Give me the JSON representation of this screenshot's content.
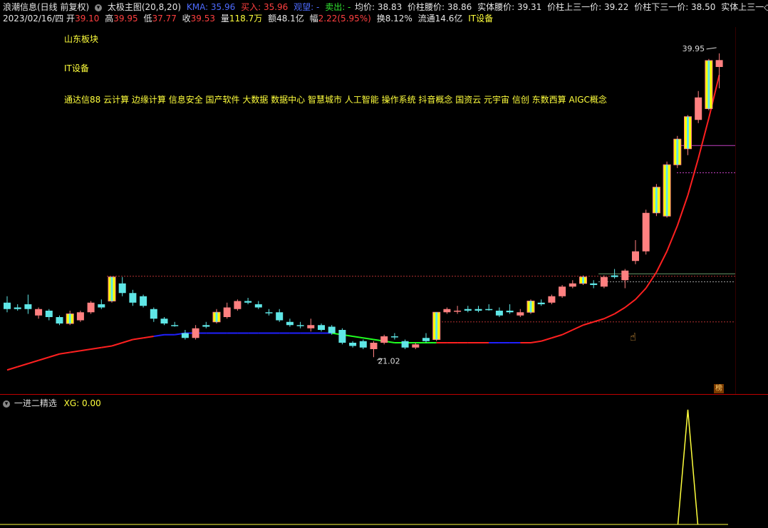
{
  "header": {
    "stock_name": "浪潮信息(日线 前复权)",
    "indicator_name": "太极主图(20,8,20)",
    "kma_label": "KMA: 35.96",
    "buy_label": "买入: 35.96",
    "watch_label": "观望: -",
    "sell_label": "卖出: -",
    "avg_price": "均价: 38.83",
    "pillar_waist": "价柱腰价: 38.86",
    "body_waist": "实体腰价: 39.31",
    "pillar_upper_third": "价柱上三一价: 39.22",
    "pillar_lower_third": "价柱下三一价: 38.50",
    "body_upper_third": "实体上三一◇"
  },
  "quote": {
    "date": "2023/02/16/四",
    "open_label": "开",
    "open": "39.10",
    "high_label": "高",
    "high": "39.95",
    "low_label": "低",
    "low": "37.77",
    "close_label": "收",
    "close": "39.53",
    "volume_label": "量",
    "volume": "118.7万",
    "amount_label": "额",
    "amount": "48.1亿",
    "change_label": "幅",
    "change": "2.22(5.95%)",
    "turnover_label": "换",
    "turnover": "8.12%",
    "float_label": "流通",
    "float": "14.6亿",
    "sector": "IT设备"
  },
  "annotations": {
    "region": "山东板块",
    "industry": "IT设备",
    "concepts": "通达信88 云计算 边缘计算 信息安全 国产软件 大数据 数据中心 智慧城市 人工智能 操作系统 抖音概念 国资云 元宇宙 信创 东数西算 AIGC概念"
  },
  "main_chart": {
    "high_marker": "39.95",
    "low_marker": "21.02",
    "badge": "榜"
  },
  "sub_chart": {
    "title": "一进二精选",
    "xg_label": "XG: 0.00"
  },
  "colors": {
    "up": "#ff8080",
    "down": "#5fe6e6",
    "strong_up": "#ffff00",
    "ma_red": "#ff2020",
    "ma_blue": "#2020ff",
    "ma_green": "#20ff20",
    "signal": "#ffff3c"
  },
  "chart_data": {
    "type": "candlestick",
    "price_range": [
      19.5,
      41.5
    ],
    "candles": [
      {
        "o": 24.4,
        "c": 24.0,
        "h": 24.8,
        "l": 23.8,
        "k": "d"
      },
      {
        "o": 24.0,
        "c": 24.1,
        "h": 24.3,
        "l": 23.9,
        "k": "d"
      },
      {
        "o": 24.0,
        "c": 24.3,
        "h": 24.9,
        "l": 23.7,
        "k": "d"
      },
      {
        "o": 24.0,
        "c": 23.6,
        "h": 24.1,
        "l": 23.4,
        "k": "u"
      },
      {
        "o": 23.9,
        "c": 23.5,
        "h": 24.0,
        "l": 23.3,
        "k": "d"
      },
      {
        "o": 23.5,
        "c": 23.1,
        "h": 23.6,
        "l": 23.0,
        "k": "d"
      },
      {
        "o": 23.1,
        "c": 23.7,
        "h": 23.9,
        "l": 23.0,
        "k": "y"
      },
      {
        "o": 23.3,
        "c": 23.8,
        "h": 23.9,
        "l": 23.2,
        "k": "u"
      },
      {
        "o": 23.8,
        "c": 24.4,
        "h": 24.5,
        "l": 23.7,
        "k": "u"
      },
      {
        "o": 24.1,
        "c": 24.3,
        "h": 24.6,
        "l": 24.0,
        "k": "d"
      },
      {
        "o": 24.5,
        "c": 26.0,
        "h": 26.0,
        "l": 24.4,
        "k": "y"
      },
      {
        "o": 25.6,
        "c": 25.0,
        "h": 26.0,
        "l": 24.8,
        "k": "d"
      },
      {
        "o": 25.0,
        "c": 24.4,
        "h": 25.2,
        "l": 24.2,
        "k": "d"
      },
      {
        "o": 24.8,
        "c": 24.2,
        "h": 24.9,
        "l": 24.1,
        "k": "d"
      },
      {
        "o": 24.0,
        "c": 23.4,
        "h": 24.1,
        "l": 23.2,
        "k": "d"
      },
      {
        "o": 23.4,
        "c": 23.1,
        "h": 23.5,
        "l": 23.0,
        "k": "d"
      },
      {
        "o": 23.0,
        "c": 23.0,
        "h": 23.2,
        "l": 22.9,
        "k": "d"
      },
      {
        "o": 22.2,
        "c": 22.5,
        "h": 22.7,
        "l": 22.1,
        "k": "d"
      },
      {
        "o": 22.2,
        "c": 22.8,
        "h": 23.0,
        "l": 22.1,
        "k": "u"
      },
      {
        "o": 22.9,
        "c": 23.0,
        "h": 23.2,
        "l": 22.8,
        "k": "d"
      },
      {
        "o": 23.2,
        "c": 23.8,
        "h": 24.0,
        "l": 23.1,
        "k": "y"
      },
      {
        "o": 23.5,
        "c": 24.1,
        "h": 24.4,
        "l": 23.4,
        "k": "u"
      },
      {
        "o": 24.0,
        "c": 24.5,
        "h": 24.6,
        "l": 23.9,
        "k": "u"
      },
      {
        "o": 24.5,
        "c": 24.4,
        "h": 24.7,
        "l": 24.3,
        "k": "d"
      },
      {
        "o": 24.3,
        "c": 24.1,
        "h": 24.5,
        "l": 24.0,
        "k": "d"
      },
      {
        "o": 23.8,
        "c": 23.8,
        "h": 24.0,
        "l": 23.6,
        "k": "d"
      },
      {
        "o": 23.8,
        "c": 23.3,
        "h": 24.0,
        "l": 23.2,
        "k": "d"
      },
      {
        "o": 23.2,
        "c": 23.0,
        "h": 23.4,
        "l": 22.9,
        "k": "d"
      },
      {
        "o": 23.0,
        "c": 23.0,
        "h": 23.2,
        "l": 22.8,
        "k": "d"
      },
      {
        "o": 22.8,
        "c": 23.0,
        "h": 23.4,
        "l": 22.6,
        "k": "u"
      },
      {
        "o": 23.0,
        "c": 22.7,
        "h": 23.1,
        "l": 22.6,
        "k": "d"
      },
      {
        "o": 22.9,
        "c": 22.5,
        "h": 23.0,
        "l": 22.4,
        "k": "d"
      },
      {
        "o": 22.7,
        "c": 21.9,
        "h": 22.8,
        "l": 21.8,
        "k": "d"
      },
      {
        "o": 21.9,
        "c": 21.7,
        "h": 22.0,
        "l": 21.6,
        "k": "d"
      },
      {
        "o": 22.0,
        "c": 21.6,
        "h": 22.1,
        "l": 21.5,
        "k": "d"
      },
      {
        "o": 21.5,
        "c": 21.9,
        "h": 22.0,
        "l": 21.0,
        "k": "u"
      },
      {
        "o": 21.9,
        "c": 22.3,
        "h": 22.4,
        "l": 21.8,
        "k": "u"
      },
      {
        "o": 22.3,
        "c": 22.3,
        "h": 22.5,
        "l": 22.1,
        "k": "d"
      },
      {
        "o": 22.0,
        "c": 21.6,
        "h": 22.1,
        "l": 21.5,
        "k": "d"
      },
      {
        "o": 21.6,
        "c": 21.8,
        "h": 21.9,
        "l": 21.5,
        "k": "u"
      },
      {
        "o": 22.0,
        "c": 22.2,
        "h": 22.5,
        "l": 21.9,
        "k": "d"
      },
      {
        "o": 22.1,
        "c": 23.8,
        "h": 23.8,
        "l": 22.0,
        "k": "y"
      },
      {
        "o": 23.8,
        "c": 24.0,
        "h": 24.1,
        "l": 23.7,
        "k": "u"
      },
      {
        "o": 23.9,
        "c": 23.9,
        "h": 24.2,
        "l": 23.7,
        "k": "u"
      },
      {
        "o": 24.0,
        "c": 23.9,
        "h": 24.2,
        "l": 23.8,
        "k": "d"
      },
      {
        "o": 23.9,
        "c": 24.0,
        "h": 24.2,
        "l": 23.8,
        "k": "d"
      },
      {
        "o": 24.0,
        "c": 24.0,
        "h": 24.3,
        "l": 23.9,
        "k": "d"
      },
      {
        "o": 23.9,
        "c": 23.6,
        "h": 24.1,
        "l": 23.5,
        "k": "d"
      },
      {
        "o": 23.8,
        "c": 23.9,
        "h": 24.3,
        "l": 23.7,
        "k": "d"
      },
      {
        "o": 23.6,
        "c": 23.8,
        "h": 24.0,
        "l": 23.5,
        "k": "u"
      },
      {
        "o": 23.8,
        "c": 24.5,
        "h": 24.6,
        "l": 23.7,
        "k": "y"
      },
      {
        "o": 24.3,
        "c": 24.4,
        "h": 24.6,
        "l": 24.2,
        "k": "d"
      },
      {
        "o": 24.4,
        "c": 24.8,
        "h": 24.9,
        "l": 24.3,
        "k": "u"
      },
      {
        "o": 24.8,
        "c": 25.4,
        "h": 25.5,
        "l": 24.7,
        "k": "u"
      },
      {
        "o": 25.4,
        "c": 25.6,
        "h": 25.8,
        "l": 25.3,
        "k": "u"
      },
      {
        "o": 25.6,
        "c": 26.0,
        "h": 26.1,
        "l": 25.5,
        "k": "y"
      },
      {
        "o": 25.6,
        "c": 25.5,
        "h": 25.8,
        "l": 25.3,
        "k": "d"
      },
      {
        "o": 25.4,
        "c": 26.0,
        "h": 26.1,
        "l": 25.3,
        "k": "u"
      },
      {
        "o": 26.0,
        "c": 26.1,
        "h": 26.5,
        "l": 25.9,
        "k": "d"
      },
      {
        "o": 25.8,
        "c": 26.4,
        "h": 26.5,
        "l": 25.3,
        "k": "u"
      },
      {
        "o": 27.0,
        "c": 27.6,
        "h": 28.3,
        "l": 26.8,
        "k": "u"
      },
      {
        "o": 27.6,
        "c": 30.0,
        "h": 30.2,
        "l": 27.4,
        "k": "u"
      },
      {
        "o": 30.0,
        "c": 31.6,
        "h": 31.8,
        "l": 29.8,
        "k": "y"
      },
      {
        "o": 29.8,
        "c": 33.0,
        "h": 33.2,
        "l": 29.7,
        "k": "y"
      },
      {
        "o": 33.0,
        "c": 34.6,
        "h": 34.8,
        "l": 32.8,
        "k": "y"
      },
      {
        "o": 34.0,
        "c": 36.0,
        "h": 36.1,
        "l": 33.6,
        "k": "y"
      },
      {
        "o": 35.8,
        "c": 37.2,
        "h": 37.6,
        "l": 35.6,
        "k": "u"
      },
      {
        "o": 36.5,
        "c": 39.5,
        "h": 39.6,
        "l": 36.4,
        "k": "y"
      },
      {
        "o": 39.1,
        "c": 39.53,
        "h": 39.95,
        "l": 37.77,
        "k": "u"
      }
    ],
    "ma": [
      20.2,
      20.4,
      20.6,
      20.8,
      21.0,
      21.2,
      21.3,
      21.4,
      21.5,
      21.6,
      21.7,
      21.9,
      22.1,
      22.2,
      22.3,
      22.4,
      22.4,
      22.5,
      22.5,
      22.5,
      22.5,
      22.5,
      22.5,
      22.5,
      22.5,
      22.5,
      22.5,
      22.5,
      22.5,
      22.5,
      22.5,
      22.5,
      22.4,
      22.3,
      22.2,
      22.1,
      22.0,
      21.9,
      21.9,
      21.9,
      21.9,
      21.9,
      21.9,
      21.9,
      21.9,
      21.9,
      21.9,
      21.9,
      21.9,
      21.9,
      21.9,
      22.0,
      22.2,
      22.4,
      22.7,
      23.0,
      23.2,
      23.4,
      23.7,
      24.1,
      24.6,
      25.3,
      26.3,
      27.6,
      29.2,
      31.1,
      33.4,
      35.9,
      38.6
    ],
    "ma_colors": [
      "r",
      "r",
      "r",
      "r",
      "r",
      "r",
      "r",
      "r",
      "r",
      "r",
      "r",
      "r",
      "r",
      "r",
      "b",
      "b",
      "b",
      "b",
      "b",
      "b",
      "b",
      "b",
      "b",
      "b",
      "b",
      "b",
      "b",
      "b",
      "b",
      "b",
      "b",
      "g",
      "g",
      "g",
      "g",
      "g",
      "g",
      "g",
      "g",
      "g",
      "g",
      "r",
      "r",
      "r",
      "r",
      "r",
      "b",
      "b",
      "b",
      "r",
      "r",
      "r",
      "r",
      "r",
      "r",
      "r",
      "r",
      "r",
      "r",
      "r",
      "r",
      "r",
      "r",
      "r",
      "r",
      "r",
      "r",
      "r",
      "r"
    ],
    "signal": {
      "peak_index": 65,
      "peak_value": 1,
      "base": 0
    }
  }
}
